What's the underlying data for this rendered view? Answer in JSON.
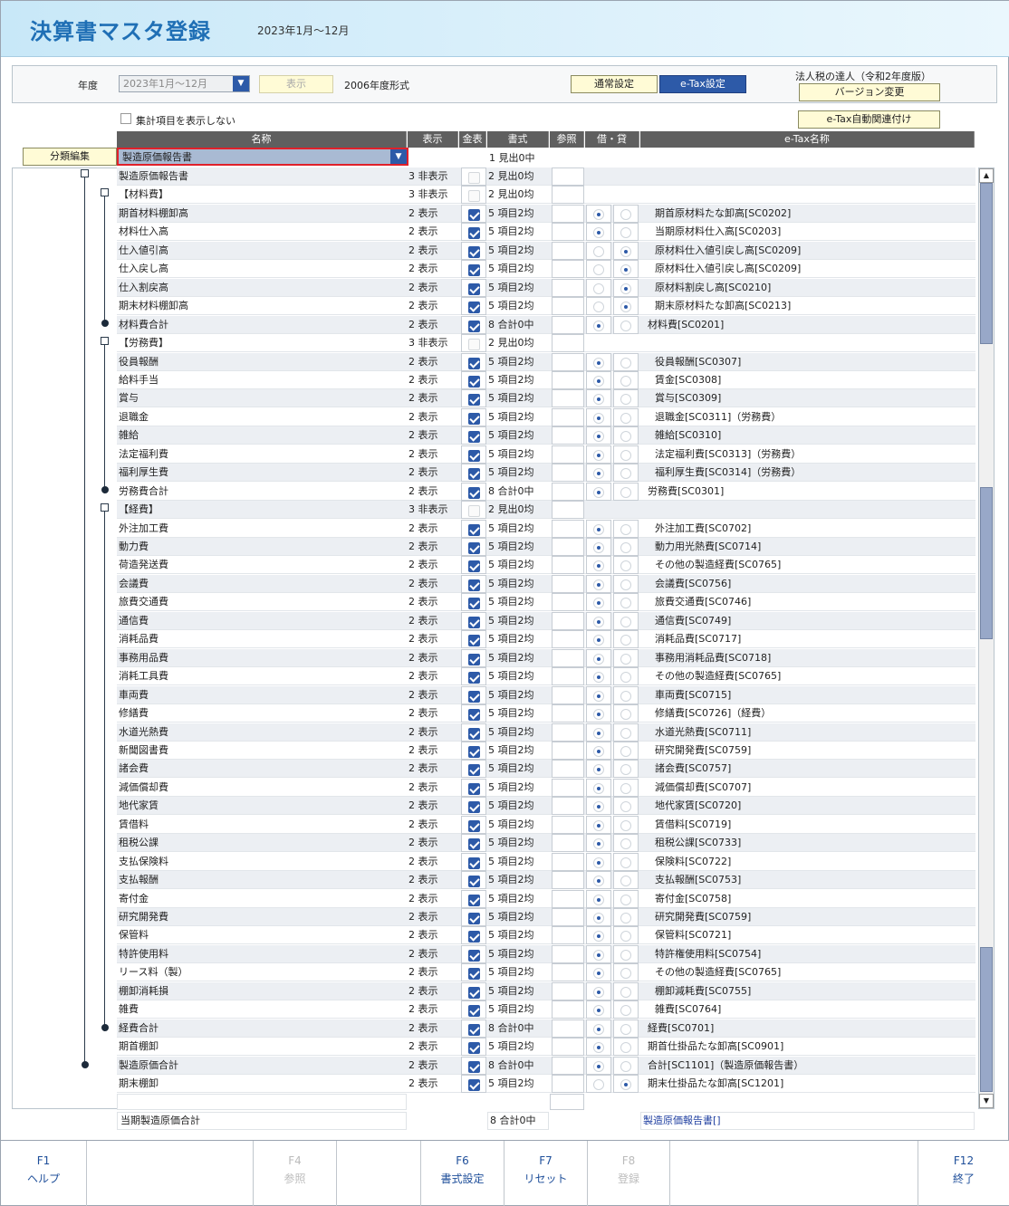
{
  "header": {
    "title": "決算書マスタ登録",
    "period": "2023年1月～12月"
  },
  "topbar": {
    "year_label": "年度",
    "year_value": "2023年1月～12月",
    "show_button": "表示",
    "format_text": "2006年度形式",
    "normal_tab": "通常設定",
    "etax_tab": "e-Tax設定",
    "tatsujin_label": "法人税の達人（令和2年度版）",
    "version_button": "バージョン変更",
    "etax_auto_button": "e-Tax自動関連付け"
  },
  "options": {
    "hide_totals": "集計項目を表示しない"
  },
  "columns": {
    "name": "名称",
    "display": "表示",
    "kinpyo": "金表",
    "format": "書式",
    "ref": "参照",
    "debit_credit": "借・貸",
    "etax": "e-Tax名称"
  },
  "classify": {
    "button": "分類編集",
    "selected": "製造原価報告書",
    "first_format": "1 見出0中"
  },
  "rows": [
    {
      "name": "製造原価報告書",
      "disp": "3 非表示",
      "chk": false,
      "fmt": "2 見出0均",
      "r": 0,
      "etax": "",
      "ind": 0,
      "alt": true
    },
    {
      "name": "【材料費】",
      "disp": "3 非表示",
      "chk": false,
      "fmt": "2 見出0均",
      "r": 0,
      "etax": "",
      "ind": 0,
      "alt": false
    },
    {
      "name": "期首材料棚卸高",
      "disp": "2 表示",
      "chk": true,
      "fmt": "5 項目2均",
      "r": 1,
      "etax": "期首原材料たな卸高[SC0202]",
      "ind": 1,
      "alt": true
    },
    {
      "name": "材料仕入高",
      "disp": "2 表示",
      "chk": true,
      "fmt": "5 項目2均",
      "r": 1,
      "etax": "当期原材料仕入高[SC0203]",
      "ind": 1,
      "alt": false
    },
    {
      "name": "仕入値引高",
      "disp": "2 表示",
      "chk": true,
      "fmt": "5 項目2均",
      "r": 2,
      "etax": "原材料仕入値引戻し高[SC0209]",
      "ind": 1,
      "alt": true
    },
    {
      "name": "仕入戻し高",
      "disp": "2 表示",
      "chk": true,
      "fmt": "5 項目2均",
      "r": 2,
      "etax": "原材料仕入値引戻し高[SC0209]",
      "ind": 1,
      "alt": false
    },
    {
      "name": "仕入割戻高",
      "disp": "2 表示",
      "chk": true,
      "fmt": "5 項目2均",
      "r": 2,
      "etax": "原材料割戻し高[SC0210]",
      "ind": 1,
      "alt": true
    },
    {
      "name": "期末材料棚卸高",
      "disp": "2 表示",
      "chk": true,
      "fmt": "5 項目2均",
      "r": 2,
      "etax": "期末原材料たな卸高[SC0213]",
      "ind": 1,
      "alt": false
    },
    {
      "name": "材料費合計",
      "disp": "2 表示",
      "chk": true,
      "fmt": "8 合計0中",
      "r": 1,
      "etax": "材料費[SC0201]",
      "ind": 0,
      "alt": true
    },
    {
      "name": "【労務費】",
      "disp": "3 非表示",
      "chk": false,
      "fmt": "2 見出0均",
      "r": 0,
      "etax": "",
      "ind": 0,
      "alt": false
    },
    {
      "name": "役員報酬",
      "disp": "2 表示",
      "chk": true,
      "fmt": "5 項目2均",
      "r": 1,
      "etax": "役員報酬[SC0307]",
      "ind": 1,
      "alt": true
    },
    {
      "name": "給料手当",
      "disp": "2 表示",
      "chk": true,
      "fmt": "5 項目2均",
      "r": 1,
      "etax": "賃金[SC0308]",
      "ind": 1,
      "alt": false
    },
    {
      "name": "賞与",
      "disp": "2 表示",
      "chk": true,
      "fmt": "5 項目2均",
      "r": 1,
      "etax": "賞与[SC0309]",
      "ind": 1,
      "alt": true
    },
    {
      "name": "退職金",
      "disp": "2 表示",
      "chk": true,
      "fmt": "5 項目2均",
      "r": 1,
      "etax": "退職金[SC0311]（労務費）",
      "ind": 1,
      "alt": false
    },
    {
      "name": "雑給",
      "disp": "2 表示",
      "chk": true,
      "fmt": "5 項目2均",
      "r": 1,
      "etax": "雑給[SC0310]",
      "ind": 1,
      "alt": true
    },
    {
      "name": "法定福利費",
      "disp": "2 表示",
      "chk": true,
      "fmt": "5 項目2均",
      "r": 1,
      "etax": "法定福利費[SC0313]（労務費）",
      "ind": 1,
      "alt": false
    },
    {
      "name": "福利厚生費",
      "disp": "2 表示",
      "chk": true,
      "fmt": "5 項目2均",
      "r": 1,
      "etax": "福利厚生費[SC0314]（労務費）",
      "ind": 1,
      "alt": true
    },
    {
      "name": "労務費合計",
      "disp": "2 表示",
      "chk": true,
      "fmt": "8 合計0中",
      "r": 1,
      "etax": "労務費[SC0301]",
      "ind": 0,
      "alt": false
    },
    {
      "name": "【経費】",
      "disp": "3 非表示",
      "chk": false,
      "fmt": "2 見出0均",
      "r": 0,
      "etax": "",
      "ind": 0,
      "alt": true
    },
    {
      "name": "外注加工費",
      "disp": "2 表示",
      "chk": true,
      "fmt": "5 項目2均",
      "r": 1,
      "etax": "外注加工費[SC0702]",
      "ind": 1,
      "alt": false
    },
    {
      "name": "動力費",
      "disp": "2 表示",
      "chk": true,
      "fmt": "5 項目2均",
      "r": 1,
      "etax": "動力用光熱費[SC0714]",
      "ind": 1,
      "alt": true
    },
    {
      "name": "荷造発送費",
      "disp": "2 表示",
      "chk": true,
      "fmt": "5 項目2均",
      "r": 1,
      "etax": "その他の製造経費[SC0765]",
      "ind": 1,
      "alt": false
    },
    {
      "name": "会議費",
      "disp": "2 表示",
      "chk": true,
      "fmt": "5 項目2均",
      "r": 1,
      "etax": "会議費[SC0756]",
      "ind": 1,
      "alt": true
    },
    {
      "name": "旅費交通費",
      "disp": "2 表示",
      "chk": true,
      "fmt": "5 項目2均",
      "r": 1,
      "etax": "旅費交通費[SC0746]",
      "ind": 1,
      "alt": false
    },
    {
      "name": "通信費",
      "disp": "2 表示",
      "chk": true,
      "fmt": "5 項目2均",
      "r": 1,
      "etax": "通信費[SC0749]",
      "ind": 1,
      "alt": true
    },
    {
      "name": "消耗品費",
      "disp": "2 表示",
      "chk": true,
      "fmt": "5 項目2均",
      "r": 1,
      "etax": "消耗品費[SC0717]",
      "ind": 1,
      "alt": false
    },
    {
      "name": "事務用品費",
      "disp": "2 表示",
      "chk": true,
      "fmt": "5 項目2均",
      "r": 1,
      "etax": "事務用消耗品費[SC0718]",
      "ind": 1,
      "alt": true
    },
    {
      "name": "消耗工具費",
      "disp": "2 表示",
      "chk": true,
      "fmt": "5 項目2均",
      "r": 1,
      "etax": "その他の製造経費[SC0765]",
      "ind": 1,
      "alt": false
    },
    {
      "name": "車両費",
      "disp": "2 表示",
      "chk": true,
      "fmt": "5 項目2均",
      "r": 1,
      "etax": "車両費[SC0715]",
      "ind": 1,
      "alt": true
    },
    {
      "name": "修繕費",
      "disp": "2 表示",
      "chk": true,
      "fmt": "5 項目2均",
      "r": 1,
      "etax": "修繕費[SC0726]（経費）",
      "ind": 1,
      "alt": false
    },
    {
      "name": "水道光熱費",
      "disp": "2 表示",
      "chk": true,
      "fmt": "5 項目2均",
      "r": 1,
      "etax": "水道光熱費[SC0711]",
      "ind": 1,
      "alt": true
    },
    {
      "name": "新聞図書費",
      "disp": "2 表示",
      "chk": true,
      "fmt": "5 項目2均",
      "r": 1,
      "etax": "研究開発費[SC0759]",
      "ind": 1,
      "alt": false
    },
    {
      "name": "諸会費",
      "disp": "2 表示",
      "chk": true,
      "fmt": "5 項目2均",
      "r": 1,
      "etax": "諸会費[SC0757]",
      "ind": 1,
      "alt": true
    },
    {
      "name": "減価償却費",
      "disp": "2 表示",
      "chk": true,
      "fmt": "5 項目2均",
      "r": 1,
      "etax": "減価償却費[SC0707]",
      "ind": 1,
      "alt": false
    },
    {
      "name": "地代家賃",
      "disp": "2 表示",
      "chk": true,
      "fmt": "5 項目2均",
      "r": 1,
      "etax": "地代家賃[SC0720]",
      "ind": 1,
      "alt": true
    },
    {
      "name": "賃借料",
      "disp": "2 表示",
      "chk": true,
      "fmt": "5 項目2均",
      "r": 1,
      "etax": "賃借料[SC0719]",
      "ind": 1,
      "alt": false
    },
    {
      "name": "租税公課",
      "disp": "2 表示",
      "chk": true,
      "fmt": "5 項目2均",
      "r": 1,
      "etax": "租税公課[SC0733]",
      "ind": 1,
      "alt": true
    },
    {
      "name": "支払保険料",
      "disp": "2 表示",
      "chk": true,
      "fmt": "5 項目2均",
      "r": 1,
      "etax": "保険料[SC0722]",
      "ind": 1,
      "alt": false
    },
    {
      "name": "支払報酬",
      "disp": "2 表示",
      "chk": true,
      "fmt": "5 項目2均",
      "r": 1,
      "etax": "支払報酬[SC0753]",
      "ind": 1,
      "alt": true
    },
    {
      "name": "寄付金",
      "disp": "2 表示",
      "chk": true,
      "fmt": "5 項目2均",
      "r": 1,
      "etax": "寄付金[SC0758]",
      "ind": 1,
      "alt": false
    },
    {
      "name": "研究開発費",
      "disp": "2 表示",
      "chk": true,
      "fmt": "5 項目2均",
      "r": 1,
      "etax": "研究開発費[SC0759]",
      "ind": 1,
      "alt": true
    },
    {
      "name": "保管料",
      "disp": "2 表示",
      "chk": true,
      "fmt": "5 項目2均",
      "r": 1,
      "etax": "保管料[SC0721]",
      "ind": 1,
      "alt": false
    },
    {
      "name": "特許使用料",
      "disp": "2 表示",
      "chk": true,
      "fmt": "5 項目2均",
      "r": 1,
      "etax": "特許権使用料[SC0754]",
      "ind": 1,
      "alt": true
    },
    {
      "name": "リース料（製）",
      "disp": "2 表示",
      "chk": true,
      "fmt": "5 項目2均",
      "r": 1,
      "etax": "その他の製造経費[SC0765]",
      "ind": 1,
      "alt": false
    },
    {
      "name": "棚卸消耗損",
      "disp": "2 表示",
      "chk": true,
      "fmt": "5 項目2均",
      "r": 1,
      "etax": "棚卸減耗費[SC0755]",
      "ind": 1,
      "alt": true
    },
    {
      "name": "雑費",
      "disp": "2 表示",
      "chk": true,
      "fmt": "5 項目2均",
      "r": 1,
      "etax": "雑費[SC0764]",
      "ind": 1,
      "alt": false
    },
    {
      "name": "経費合計",
      "disp": "2 表示",
      "chk": true,
      "fmt": "8 合計0中",
      "r": 1,
      "etax": "経費[SC0701]",
      "ind": 0,
      "alt": true
    },
    {
      "name": "期首棚卸",
      "disp": "2 表示",
      "chk": true,
      "fmt": "5 項目2均",
      "r": 1,
      "etax": "期首仕掛品たな卸高[SC0901]",
      "ind": 0,
      "alt": false
    },
    {
      "name": "製造原価合計",
      "disp": "2 表示",
      "chk": true,
      "fmt": "8 合計0中",
      "r": 1,
      "etax": "合計[SC1101]（製造原価報告書）",
      "ind": 0,
      "alt": true
    },
    {
      "name": "期末棚卸",
      "disp": "2 表示",
      "chk": true,
      "fmt": "5 項目2均",
      "r": 2,
      "etax": "期末仕掛品たな卸高[SC1201]",
      "ind": 0,
      "alt": false
    }
  ],
  "summary": {
    "name": "当期製造原価合計",
    "fmt": "8 合計0中",
    "etax": "製造原価報告書[]"
  },
  "fkeys": [
    {
      "key": "F1",
      "label": "ヘルプ",
      "enabled": true
    },
    {
      "key": "F4",
      "label": "参照",
      "enabled": false
    },
    {
      "key": "F6",
      "label": "書式設定",
      "enabled": true
    },
    {
      "key": "F7",
      "label": "リセット",
      "enabled": true
    },
    {
      "key": "F8",
      "label": "登録",
      "enabled": false
    },
    {
      "key": "F12",
      "label": "終了",
      "enabled": true
    }
  ]
}
